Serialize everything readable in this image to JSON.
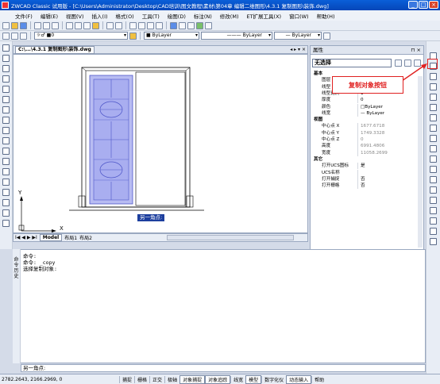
{
  "window": {
    "title": "ZWCAD Classic 试用版 - [C:\\Users\\Administrator\\Desktop\\CAD培训\\图文教程\\素材\\第04章 编辑二维图形\\4.3.1 复制图形\\装饰.dwg]",
    "minimize": "_",
    "maximize": "□",
    "close": "×"
  },
  "menu": {
    "items": [
      "文件(F)",
      "编辑(E)",
      "视图(V)",
      "插入(I)",
      "格式(O)",
      "工具(T)",
      "绘图(D)",
      "标注(N)",
      "修改(M)",
      "ET扩展工具(X)",
      "窗口(W)",
      "帮助(H)"
    ]
  },
  "toolbar2": {
    "layer_value": "0",
    "color_value": "ByLayer",
    "linetype_value": "ByLayer",
    "lineweight_value": "ByLayer"
  },
  "drawing": {
    "tab_title": "C:\\...\\4.3.1 复制图形\\装饰.dwg",
    "tooltip": "另一角点:",
    "axis_y": "Y",
    "axis_x": "X"
  },
  "layout_tabs": {
    "nav": "I◀ ◀ ▶ ▶I",
    "model": "Model",
    "layout1": "布局1",
    "layout2": "布局2"
  },
  "properties": {
    "header": "属性",
    "selection": "无选择",
    "rows": [
      {
        "key": "基本",
        "value": "",
        "cat": true
      },
      {
        "key": "图层",
        "value": "0"
      },
      {
        "key": "线型",
        "value": "ByLayer"
      },
      {
        "key": "线型比例",
        "value": "1"
      },
      {
        "key": "厚度",
        "value": "0"
      },
      {
        "key": "颜色",
        "value": "□ByLayer"
      },
      {
        "key": "线宽",
        "value": "— ByLayer"
      },
      {
        "key": "视图",
        "value": "",
        "cat": true
      },
      {
        "key": "中心点 X",
        "value": "1677.6718",
        "gray": true
      },
      {
        "key": "中心点 Y",
        "value": "1749.3328",
        "gray": true
      },
      {
        "key": "中心点 Z",
        "value": "0",
        "gray": true
      },
      {
        "key": "高度",
        "value": "6991.4806",
        "gray": true
      },
      {
        "key": "宽度",
        "value": "11058.2699",
        "gray": true
      },
      {
        "key": "其它",
        "value": "",
        "cat": true
      },
      {
        "key": "打开UCS图标",
        "value": "是"
      },
      {
        "key": "UCS名称",
        "value": ""
      },
      {
        "key": "打开捕捉",
        "value": "否"
      },
      {
        "key": "打开栅格",
        "value": "否"
      }
    ]
  },
  "callout": {
    "text": "复制对象按钮"
  },
  "command": {
    "side_label": "命令历史",
    "lines": [
      "命令:",
      "命令: _copy",
      "选择复制对象:"
    ],
    "input": "另一角点:"
  },
  "status": {
    "coords": "2782.2643,  2166.2969,  0",
    "buttons": [
      "捕捉",
      "栅格",
      "正交",
      "极轴",
      "对象捕捉",
      "对象追踪",
      "线宽",
      "模型",
      "数字化仪",
      "动态输入",
      "帮助"
    ],
    "active": [
      "对象捕捉",
      "对象追踪",
      "模型",
      "动态输入"
    ]
  },
  "colors": {
    "title_bar": "#0a5fd8",
    "door_fill": "#a9aef0",
    "callout": "#e02020"
  }
}
